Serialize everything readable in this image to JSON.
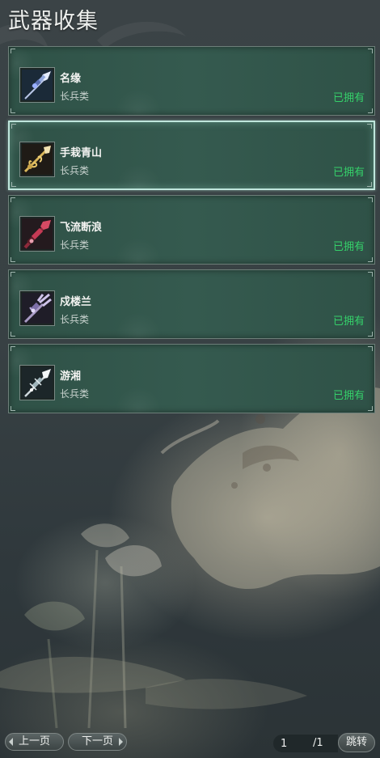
{
  "header": {
    "title": "武器收集"
  },
  "weapons": [
    {
      "name": "名缘",
      "type": "长兵类",
      "status": "已拥有",
      "icon": "silver-spear-icon",
      "selected": false
    },
    {
      "name": "手栽青山",
      "type": "长兵类",
      "status": "已拥有",
      "icon": "golden-spear-icon",
      "selected": true
    },
    {
      "name": "飞流断浪",
      "type": "长兵类",
      "status": "已拥有",
      "icon": "crimson-spear-icon",
      "selected": false
    },
    {
      "name": "戍楼兰",
      "type": "长兵类",
      "status": "已拥有",
      "icon": "trident-spear-icon",
      "selected": false
    },
    {
      "name": "游湘",
      "type": "长兵类",
      "status": "已拥有",
      "icon": "frost-spear-icon",
      "selected": false
    }
  ],
  "pagination": {
    "prev_label": "上一页",
    "next_label": "下一页",
    "current_page": "1",
    "total_pages": "/1",
    "jump_label": "跳转"
  },
  "colors": {
    "card_bg": "#33564b",
    "owned_text": "#35d06a",
    "selected_border": "#bfe6dc"
  }
}
